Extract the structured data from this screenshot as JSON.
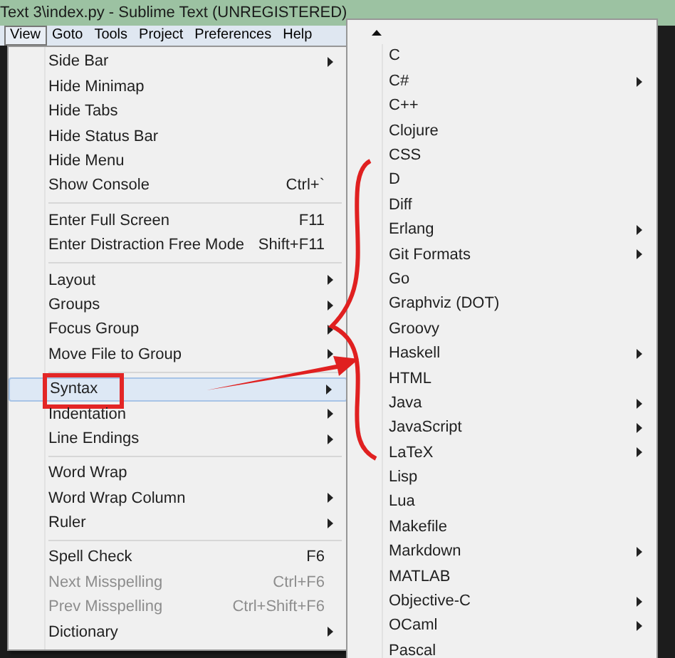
{
  "window": {
    "title": "Text 3\\index.py - Sublime Text (UNREGISTERED)"
  },
  "menu_bar": [
    {
      "label": "View",
      "selected": true
    },
    {
      "label": "Goto",
      "selected": false
    },
    {
      "label": "Tools",
      "selected": false
    },
    {
      "label": "Project",
      "selected": false
    },
    {
      "label": "Preferences",
      "selected": false
    },
    {
      "label": "Help",
      "selected": false
    }
  ],
  "view_menu": [
    {
      "kind": "item",
      "label": "Side Bar",
      "submenu": true
    },
    {
      "kind": "item",
      "label": "Hide Minimap"
    },
    {
      "kind": "item",
      "label": "Hide Tabs"
    },
    {
      "kind": "item",
      "label": "Hide Status Bar"
    },
    {
      "kind": "item",
      "label": "Hide Menu"
    },
    {
      "kind": "item",
      "label": "Show Console",
      "shortcut": "Ctrl+`"
    },
    {
      "kind": "separator"
    },
    {
      "kind": "item",
      "label": "Enter Full Screen",
      "shortcut": "F11"
    },
    {
      "kind": "item",
      "label": "Enter Distraction Free Mode",
      "shortcut": "Shift+F11"
    },
    {
      "kind": "separator"
    },
    {
      "kind": "item",
      "label": "Layout",
      "submenu": true
    },
    {
      "kind": "item",
      "label": "Groups",
      "submenu": true
    },
    {
      "kind": "item",
      "label": "Focus Group",
      "submenu": true
    },
    {
      "kind": "item",
      "label": "Move File to Group",
      "submenu": true
    },
    {
      "kind": "separator"
    },
    {
      "kind": "item",
      "label": "Syntax",
      "submenu": true,
      "selected": true,
      "annotated": true
    },
    {
      "kind": "item",
      "label": "Indentation",
      "submenu": true
    },
    {
      "kind": "item",
      "label": "Line Endings",
      "submenu": true
    },
    {
      "kind": "separator"
    },
    {
      "kind": "item",
      "label": "Word Wrap"
    },
    {
      "kind": "item",
      "label": "Word Wrap Column",
      "submenu": true
    },
    {
      "kind": "item",
      "label": "Ruler",
      "submenu": true
    },
    {
      "kind": "separator"
    },
    {
      "kind": "item",
      "label": "Spell Check",
      "shortcut": "F6"
    },
    {
      "kind": "item",
      "label": "Next Misspelling",
      "shortcut": "Ctrl+F6",
      "disabled": true
    },
    {
      "kind": "item",
      "label": "Prev Misspelling",
      "shortcut": "Ctrl+Shift+F6",
      "disabled": true
    },
    {
      "kind": "item",
      "label": "Dictionary",
      "submenu": true
    }
  ],
  "syntax_menu": [
    {
      "label": "C"
    },
    {
      "label": "C#",
      "submenu": true
    },
    {
      "label": "C++"
    },
    {
      "label": "Clojure"
    },
    {
      "label": "CSS"
    },
    {
      "label": "D"
    },
    {
      "label": "Diff"
    },
    {
      "label": "Erlang",
      "submenu": true
    },
    {
      "label": "Git Formats",
      "submenu": true
    },
    {
      "label": "Go"
    },
    {
      "label": "Graphviz (DOT)"
    },
    {
      "label": "Groovy"
    },
    {
      "label": "Haskell",
      "submenu": true
    },
    {
      "label": "HTML"
    },
    {
      "label": "Java",
      "submenu": true
    },
    {
      "label": "JavaScript",
      "submenu": true
    },
    {
      "label": "LaTeX",
      "submenu": true
    },
    {
      "label": "Lisp"
    },
    {
      "label": "Lua"
    },
    {
      "label": "Makefile"
    },
    {
      "label": "Markdown",
      "submenu": true
    },
    {
      "label": "MATLAB"
    },
    {
      "label": "Objective-C",
      "submenu": true
    },
    {
      "label": "OCaml",
      "submenu": true
    },
    {
      "label": "Pascal"
    }
  ]
}
